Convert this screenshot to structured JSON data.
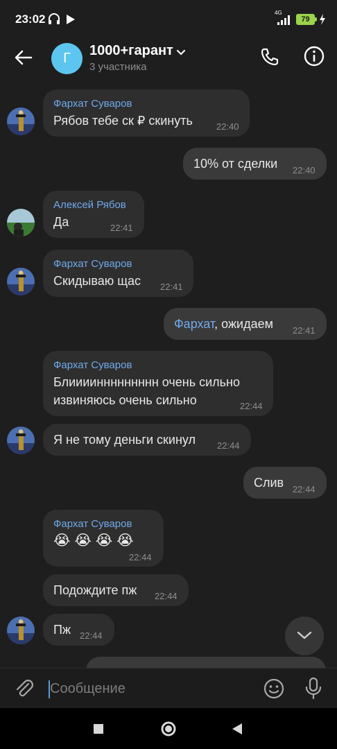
{
  "status_bar": {
    "time": "23:02",
    "network": "4G",
    "battery": "79",
    "icons": [
      "headphones-icon",
      "play-icon",
      "signal-icon",
      "battery-icon",
      "charging-icon"
    ]
  },
  "header": {
    "avatar_letter": "Г",
    "avatar_color": "#5cc6f0",
    "title": "1000+гарант",
    "subtitle": "3 участника",
    "icons": [
      "back-arrow-icon",
      "chevron-down-icon",
      "phone-icon",
      "info-icon"
    ]
  },
  "messages": [
    {
      "from": "Фархат Суваров",
      "text": "Рябов тебе ск ₽ скинуть",
      "time": "22:40"
    },
    {
      "out": true,
      "text": "10% от сделки",
      "time": "22:40"
    },
    {
      "from": "Алексей Рябов",
      "text": "Да",
      "time": "22:41"
    },
    {
      "from": "Фархат Суваров",
      "text": "Скидываю щас",
      "time": "22:41"
    },
    {
      "out": true,
      "mention": "Фархат",
      "text": ", ожидаем",
      "time": "22:41"
    },
    {
      "from": "Фархат Суваров",
      "text_line1": "Блииииннннннннн очень сильно",
      "text_line2": "извиняюсь очень сильно",
      "time": "22:44"
    },
    {
      "text": "Я не тому деньги скинул",
      "time": "22:44"
    },
    {
      "out": true,
      "text": "Слив",
      "time": "22:44"
    },
    {
      "from": "Фархат Суваров",
      "text": "😭 😭 😭 😭",
      "time": "22:44"
    },
    {
      "text": "Подождите пж",
      "time": "22:44"
    },
    {
      "text": "Пж",
      "time": "22:44"
    }
  ],
  "composer": {
    "placeholder": "Сообщение",
    "icons": [
      "attach-icon",
      "emoji-icon",
      "microphone-icon"
    ]
  },
  "scroll_down_icon": "chevron-down-icon",
  "nav_bar": {
    "icons": [
      "recents-square-icon",
      "home-circle-icon",
      "back-triangle-icon"
    ]
  },
  "colors": {
    "accent": "#71aaeb",
    "background": "#1e1e1e",
    "bubble_in": "#2e2e2e",
    "bubble_out": "#3a3a3a",
    "battery": "#9ad34c"
  }
}
